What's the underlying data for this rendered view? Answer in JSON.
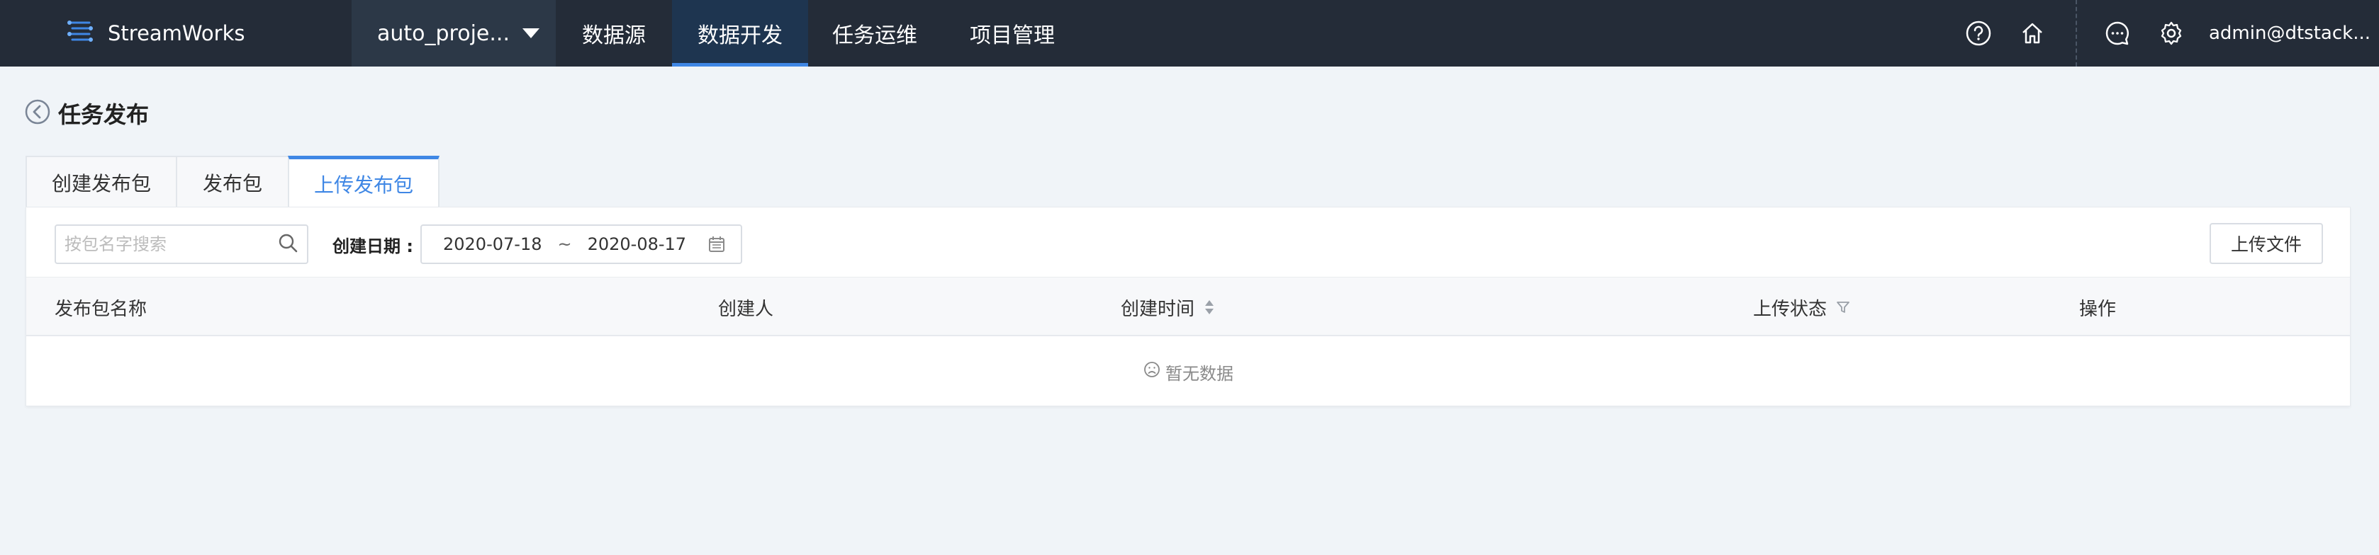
{
  "header": {
    "brand": "StreamWorks",
    "project": "auto_proje...",
    "nav": [
      "数据源",
      "数据开发",
      "任务运维",
      "项目管理"
    ],
    "active_nav": "数据开发",
    "user": "admin@dtstack..."
  },
  "page": {
    "title": "任务发布",
    "tabs": [
      "创建发布包",
      "发布包",
      "上传发布包"
    ],
    "active_tab": "上传发布包"
  },
  "toolbar": {
    "search_placeholder": "按包名字搜索",
    "date_label": "创建日期 :",
    "date_start": "2020-07-18",
    "date_sep": "~",
    "date_end": "2020-08-17",
    "upload_label": "上传文件"
  },
  "table": {
    "columns": [
      "发布包名称",
      "创建人",
      "创建时间",
      "上传状态",
      "操作"
    ],
    "empty_text": "暂无数据"
  },
  "colors": {
    "topbar": "#242c38",
    "accent": "#3f87e5",
    "background": "#f0f4f8"
  }
}
